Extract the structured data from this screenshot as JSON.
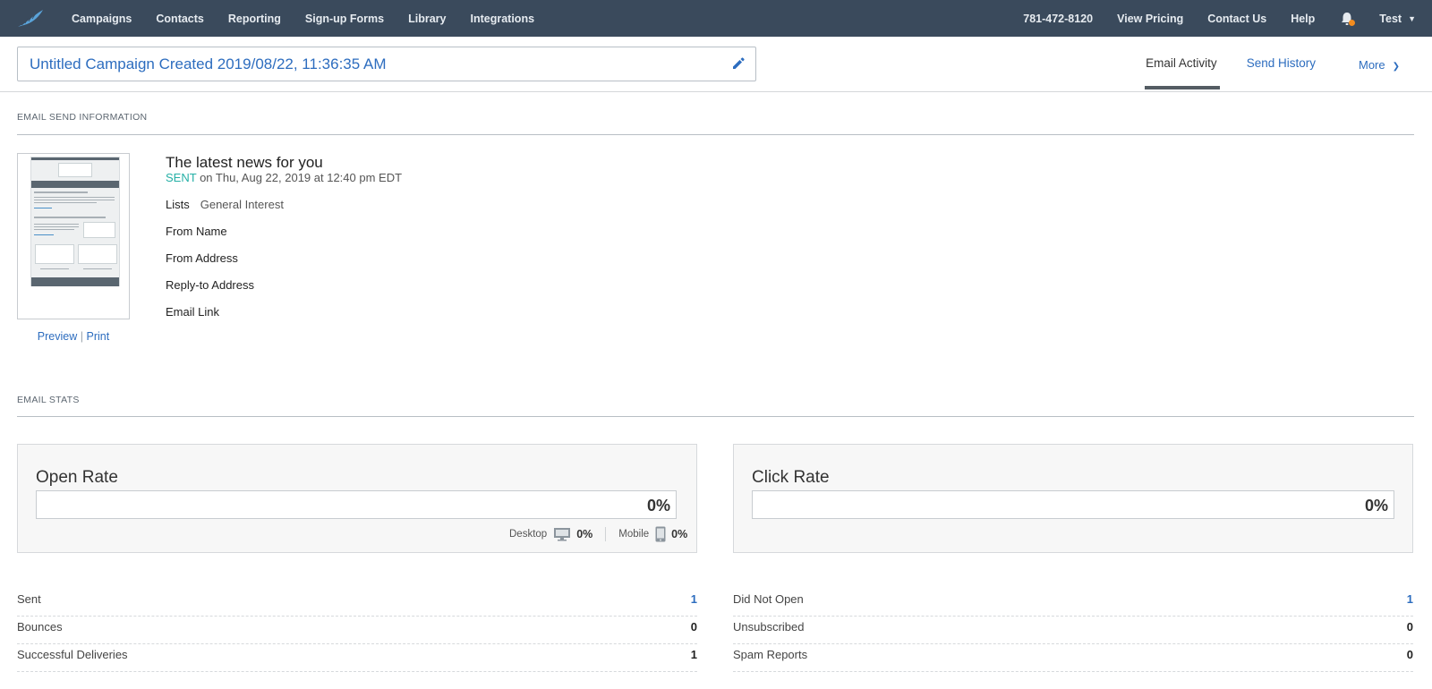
{
  "nav": {
    "left": [
      "Campaigns",
      "Contacts",
      "Reporting",
      "Sign-up Forms",
      "Library",
      "Integrations"
    ],
    "phone": "781-472-8120",
    "right": [
      "View Pricing",
      "Contact Us",
      "Help"
    ],
    "user": "Test"
  },
  "header": {
    "campaign_title": "Untitled Campaign Created 2019/08/22, 11:36:35 AM",
    "tabs": {
      "email_activity": "Email Activity",
      "send_history": "Send History",
      "more": "More"
    }
  },
  "send_info": {
    "section_label": "EMAIL SEND INFORMATION",
    "thumbnail_links": {
      "preview": "Preview",
      "print": "Print",
      "separator": "|"
    },
    "subject": "The latest news for you",
    "status": "SENT",
    "sent_on": "on Thu, Aug 22, 2019 at 12:40 pm EDT",
    "fields": [
      {
        "label": "Lists",
        "value": "General Interest"
      },
      {
        "label": "From Name",
        "value": ""
      },
      {
        "label": "From Address",
        "value": ""
      },
      {
        "label": "Reply-to Address",
        "value": ""
      },
      {
        "label": "Email Link",
        "value": ""
      }
    ]
  },
  "stats": {
    "section_label": "EMAIL STATS",
    "open_rate": {
      "title": "Open Rate",
      "value": "0%",
      "desktop_label": "Desktop",
      "desktop_value": "0%",
      "mobile_label": "Mobile",
      "mobile_value": "0%"
    },
    "click_rate": {
      "title": "Click Rate",
      "value": "0%"
    },
    "left_list": [
      {
        "label": "Sent",
        "value": "1",
        "link": true
      },
      {
        "label": "Bounces",
        "value": "0",
        "link": false
      },
      {
        "label": "Successful Deliveries",
        "value": "1",
        "link": false
      }
    ],
    "right_list": [
      {
        "label": "Did Not Open",
        "value": "1",
        "link": true
      },
      {
        "label": "Unsubscribed",
        "value": "0",
        "link": false
      },
      {
        "label": "Spam Reports",
        "value": "0",
        "link": false
      }
    ]
  },
  "colors": {
    "nav_bg": "#3a4a5c",
    "link": "#2d6dbf",
    "sent_status": "#25b0a6",
    "notification_dot": "#f28c1f"
  },
  "icons": {
    "logo": "feather-logo-icon",
    "bell": "bell-icon",
    "edit": "pencil-icon",
    "desktop": "desktop-icon",
    "mobile": "mobile-icon",
    "chevron": "chevron-down-icon"
  }
}
